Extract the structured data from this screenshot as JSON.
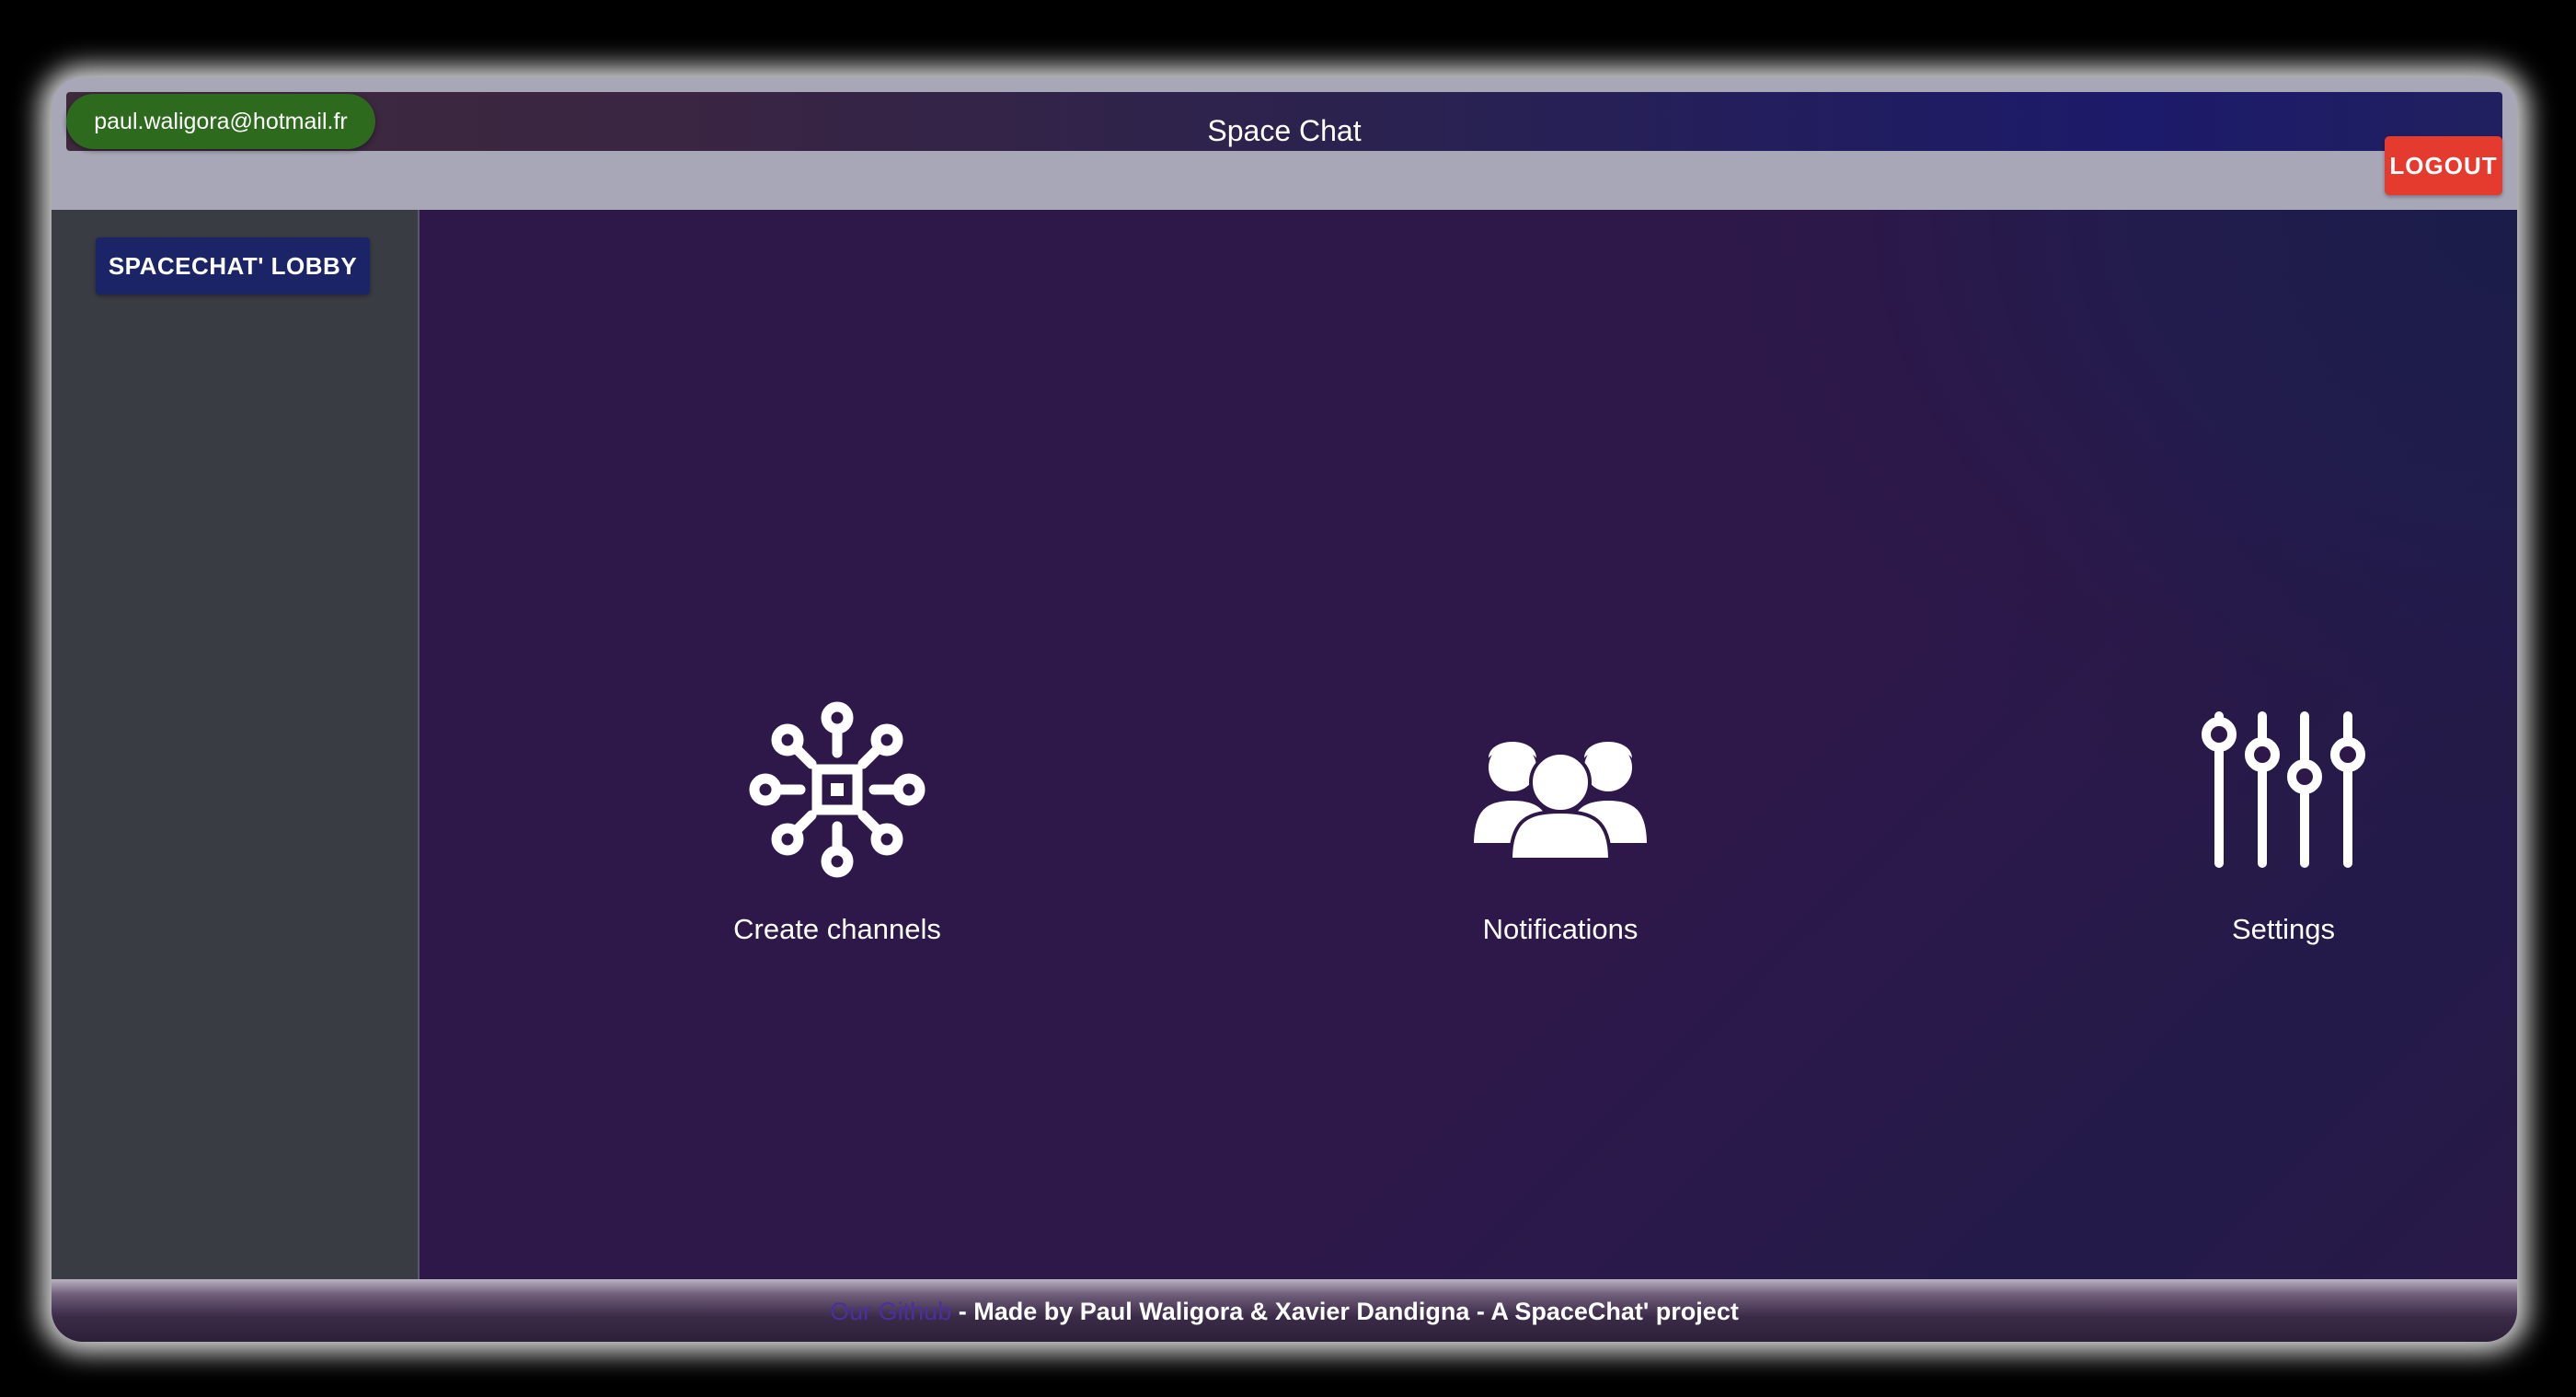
{
  "header": {
    "user_email": "paul.waligora@hotmail.fr",
    "title": "Space Chat",
    "logout_label": "LOGOUT"
  },
  "sidebar": {
    "lobby_label": "SPACECHAT' LOBBY"
  },
  "main": {
    "tiles": [
      {
        "label": "Create channels",
        "icon": "network-hub-icon"
      },
      {
        "label": "Notifications",
        "icon": "users-group-icon"
      },
      {
        "label": "Settings",
        "icon": "sliders-icon"
      }
    ]
  },
  "footer": {
    "link_label": "Our Github",
    "credits": " - Made by Paul Waligora & Xavier Dandigna - A SpaceChat' project"
  },
  "colors": {
    "user_pill": "#2d6a1d",
    "logout": "#e53a2e",
    "lobby_button": "#1a2466",
    "main_background": "#2e184a",
    "sidebar": "#3a3c44"
  }
}
